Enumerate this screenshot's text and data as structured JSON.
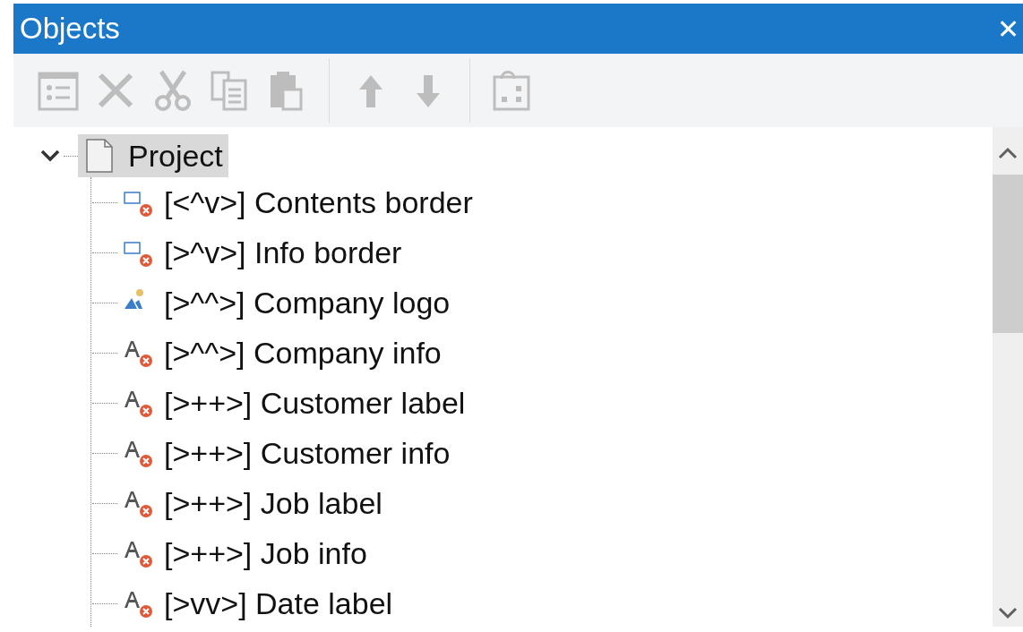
{
  "window": {
    "title": "Objects",
    "close": "✕"
  },
  "toolbar": [
    {
      "kind": "properties",
      "disabled": true
    },
    {
      "kind": "delete",
      "disabled": true
    },
    {
      "kind": "cut",
      "disabled": true
    },
    {
      "kind": "copy",
      "disabled": true
    },
    {
      "kind": "paste",
      "disabled": true
    },
    {
      "kind": "separator"
    },
    {
      "kind": "up",
      "disabled": true
    },
    {
      "kind": "down",
      "disabled": true
    },
    {
      "kind": "separator"
    },
    {
      "kind": "arrange",
      "disabled": true
    }
  ],
  "tree": {
    "label": "Project",
    "selected": true,
    "expanded": true,
    "children": [
      {
        "label": "[<^v>] Contents border",
        "kind": "shape-error",
        "selected": false
      },
      {
        "label": "[>^v>] Info border",
        "kind": "shape-error",
        "selected": false
      },
      {
        "label": "[>^^>] Company logo",
        "kind": "image",
        "selected": false
      },
      {
        "label": "[>^^>] Company info",
        "kind": "text-error",
        "selected": false
      },
      {
        "label": "[>++>] Customer label",
        "kind": "text-error",
        "selected": false
      },
      {
        "label": "[>++>] Customer info",
        "kind": "text-error",
        "selected": false
      },
      {
        "label": "[>++>] Job label",
        "kind": "text-error",
        "selected": false
      },
      {
        "label": "[>++>] Job info",
        "kind": "text-error",
        "selected": false
      },
      {
        "label": "[>vv>] Date label",
        "kind": "text-error",
        "selected": false
      }
    ]
  }
}
